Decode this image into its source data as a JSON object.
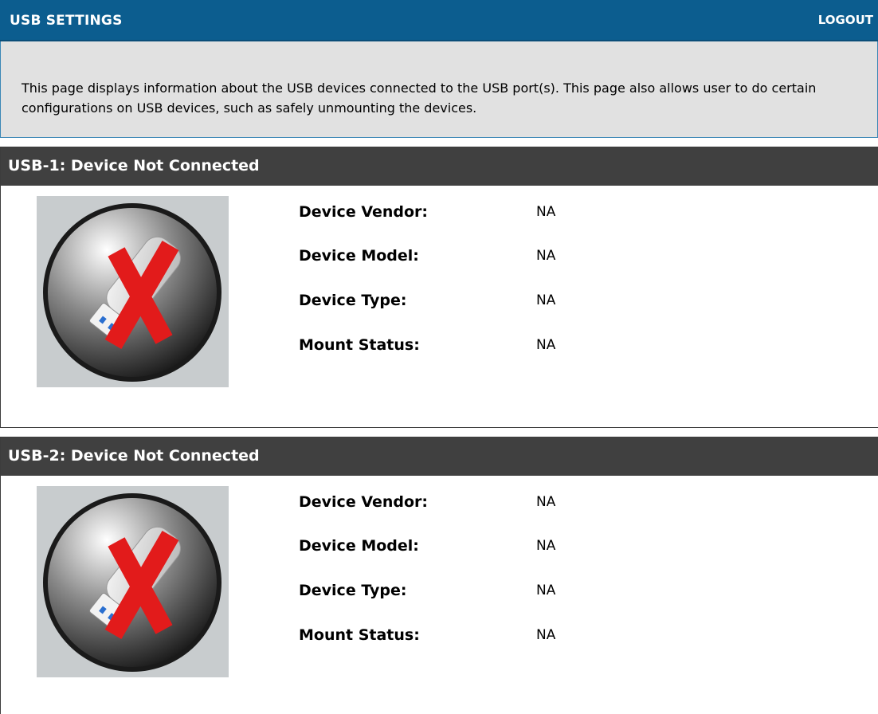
{
  "header": {
    "title": "USB SETTINGS",
    "logout_label": "LOGOUT"
  },
  "intro": {
    "text": "This page displays information about the USB devices connected to the USB port(s). This page also allows user to do certain configurations on USB devices, such as safely unmounting the devices."
  },
  "ports": [
    {
      "title": "USB-1: Device Not Connected",
      "icon": "usb-disconnected-icon",
      "fields": [
        {
          "label": "Device Vendor:",
          "value": "NA"
        },
        {
          "label": "Device Model:",
          "value": "NA"
        },
        {
          "label": "Device Type:",
          "value": "NA"
        },
        {
          "label": "Mount Status:",
          "value": "NA"
        }
      ]
    },
    {
      "title": "USB-2: Device Not Connected",
      "icon": "usb-disconnected-icon",
      "fields": [
        {
          "label": "Device Vendor:",
          "value": "NA"
        },
        {
          "label": "Device Model:",
          "value": "NA"
        },
        {
          "label": "Device Type:",
          "value": "NA"
        },
        {
          "label": "Mount Status:",
          "value": "NA"
        }
      ]
    }
  ],
  "colors": {
    "header_blue": "#0c5d8f",
    "panel_header": "#404040",
    "intro_bg": "#e1e1e1",
    "x_red": "#e21b1b"
  }
}
